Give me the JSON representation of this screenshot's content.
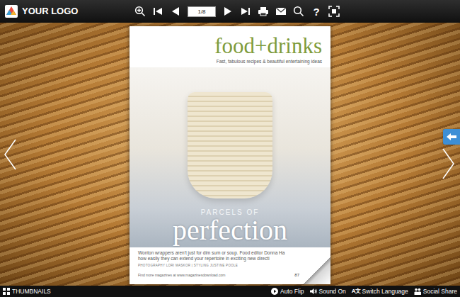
{
  "logo": {
    "text": "YOUR LOGO"
  },
  "toolbar": {
    "page_field": {
      "value": "1/8"
    },
    "help_icon": "?"
  },
  "magazine": {
    "section_title": "food+drinks",
    "tagline": "Fast, fabulous recipes & beautiful entertaining ideas",
    "kicker": "PARCELS OF",
    "headline": "perfection",
    "intro_lines": [
      "Wonton wrappers aren't just for dim sum or soup. Food editor Donna Ha",
      "how easily they can extend your repertoire in exciting new directi"
    ],
    "credits": "PHOTOGRAPHY LORI MASKOR | STYLING JUSTINE POOLE",
    "footer": "Find more magazines at www.magazinesdownload.com",
    "page_number": "87"
  },
  "bottom_bar": {
    "thumbnails": {
      "label": "THUMBNAILS"
    },
    "controls": [
      {
        "label": "Auto Flip",
        "kind": "play"
      },
      {
        "label": "Sound On",
        "kind": "sound"
      },
      {
        "label": "Switch Language",
        "kind": "language",
        "icon": "A文"
      },
      {
        "label": "Social Share",
        "kind": "share"
      }
    ]
  }
}
